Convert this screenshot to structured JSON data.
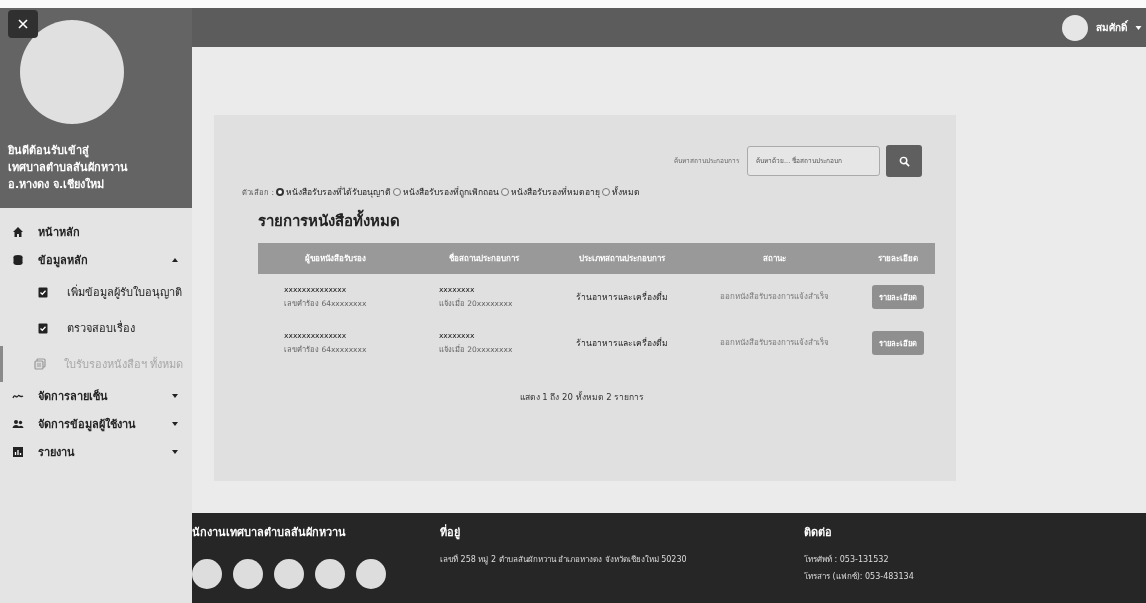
{
  "sidebar": {
    "welcome": [
      "ยินดีต้อนรับเข้าสู่",
      "เทศบาลตำบลสันผักหวาน",
      "อ.หางดง จ.เชียงใหม่"
    ],
    "items": [
      {
        "kind": "item",
        "label": "หน้าหลัก"
      },
      {
        "kind": "group",
        "label": "ข้อมูลหลัก",
        "expanded": true,
        "children": [
          {
            "label": "เพิ่มข้อมูลผู้รับใบอนุญาติ",
            "selected": false
          },
          {
            "label": "ตรวจสอบเรื่อง",
            "selected": false
          },
          {
            "label": "ใบรับรองหนังสือฯ ทั้งหมด",
            "selected": true
          }
        ]
      },
      {
        "kind": "group",
        "label": "จัดการลายเซ็น",
        "expanded": false
      },
      {
        "kind": "group",
        "label": "จัดการข้อมูลผู้ใช้งาน",
        "expanded": false
      },
      {
        "kind": "group",
        "label": "รายงาน",
        "expanded": false
      }
    ]
  },
  "topbar": {
    "user": "สมศักดิ์"
  },
  "search": {
    "label": "ค้นหาสถานประกอบการ",
    "placeholder": "ค้นหาด้วย... ชื่อสถานประกอบก"
  },
  "filter": {
    "label": "ตัวเลือก :",
    "options": [
      {
        "label": "หนังสือรับรองที่ได้รับอนุญาติ",
        "selected": true
      },
      {
        "label": "หนังสือรับรองที่ถูกเพิกถอน",
        "selected": false
      },
      {
        "label": "หนังสือรับรองที่หมดอายุ",
        "selected": false
      },
      {
        "label": "ทั้งหมด",
        "selected": false
      }
    ]
  },
  "heading": "รายการหนังสือทั้งหมด",
  "table": {
    "columns": [
      "ผู้ขอหนังสือรับรอง",
      "ชื่อสถานประกอบการ",
      "ประเภทสถานประกอบการ",
      "สถานะ",
      "รายละเอียด"
    ],
    "rows": [
      {
        "applicant": "xxxxxxxxxxxxxx",
        "request_no": "เลขคำร้อง 64xxxxxxxx",
        "business": "xxxxxxxx",
        "notified": "แจ้งเมื่อ 20xxxxxxxx",
        "type": "ร้านอาหารและเครื่องดื่ม",
        "status": "ออกหนังสือรับรองการแจ้งสำเร็จ",
        "action": "รายละเอียด"
      },
      {
        "applicant": "xxxxxxxxxxxxxx",
        "request_no": "เลขคำร้อง 64xxxxxxxx",
        "business": "xxxxxxxx",
        "notified": "แจ้งเมื่อ 20xxxxxxxx",
        "type": "ร้านอาหารและเครื่องดื่ม",
        "status": "ออกหนังสือรับรองการแจ้งสำเร็จ",
        "action": "รายละเอียด"
      }
    ]
  },
  "pagination": "แสดง 1 ถึง 20 ทั้งหมด 2 รายการ",
  "footer": {
    "org": "นักงานเทศบาลตำบลสันผักหวาน",
    "address_title": "ที่อยู่",
    "address": "เลขที่ 258 หมู่ 2 ตำบลสันผักหวาน อำเภอหางดง จังหวัดเชียงใหม่ 50230",
    "contact_title": "ติดต่อ",
    "contacts": [
      "โทรศัพท์ : 053-131532",
      "โทรสาร (แฟกซ์): 053-483134"
    ]
  }
}
